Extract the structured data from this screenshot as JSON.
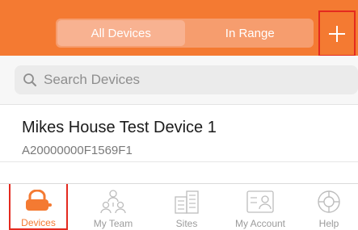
{
  "header": {
    "segments": [
      {
        "label": "All Devices",
        "active": true
      },
      {
        "label": "In Range",
        "active": false
      }
    ],
    "add_icon": "plus-icon",
    "accent": "#f47a32"
  },
  "search": {
    "placeholder": "Search Devices",
    "value": "",
    "icon": "search-icon"
  },
  "devices": [
    {
      "name": "Mikes House Test Device 1",
      "id": "A20000000F1569F1"
    }
  ],
  "tabbar": {
    "items": [
      {
        "label": "Devices",
        "icon": "padlock-icon",
        "active": true
      },
      {
        "label": "My Team",
        "icon": "team-icon",
        "active": false
      },
      {
        "label": "Sites",
        "icon": "buildings-icon",
        "active": false
      },
      {
        "label": "My Account",
        "icon": "account-card-icon",
        "active": false
      },
      {
        "label": "Help",
        "icon": "lifebuoy-icon",
        "active": false
      }
    ]
  }
}
